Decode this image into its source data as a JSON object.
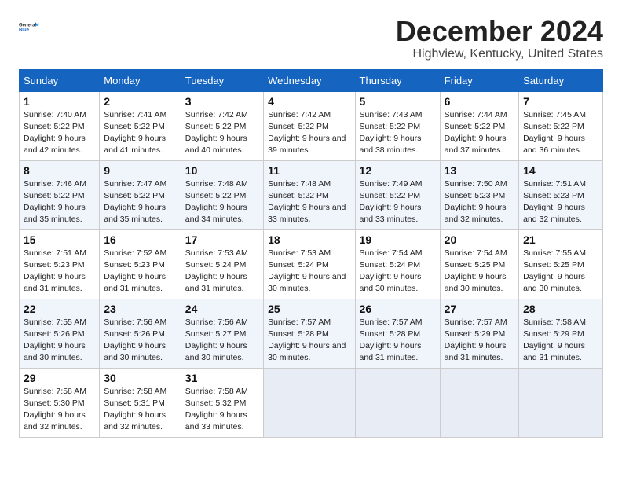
{
  "logo": {
    "line1": "General",
    "line2": "Blue"
  },
  "title": "December 2024",
  "location": "Highview, Kentucky, United States",
  "headers": [
    "Sunday",
    "Monday",
    "Tuesday",
    "Wednesday",
    "Thursday",
    "Friday",
    "Saturday"
  ],
  "weeks": [
    [
      {
        "day": "1",
        "sunrise": "7:40 AM",
        "sunset": "5:22 PM",
        "daylight": "9 hours and 42 minutes."
      },
      {
        "day": "2",
        "sunrise": "7:41 AM",
        "sunset": "5:22 PM",
        "daylight": "9 hours and 41 minutes."
      },
      {
        "day": "3",
        "sunrise": "7:42 AM",
        "sunset": "5:22 PM",
        "daylight": "9 hours and 40 minutes."
      },
      {
        "day": "4",
        "sunrise": "7:42 AM",
        "sunset": "5:22 PM",
        "daylight": "9 hours and 39 minutes."
      },
      {
        "day": "5",
        "sunrise": "7:43 AM",
        "sunset": "5:22 PM",
        "daylight": "9 hours and 38 minutes."
      },
      {
        "day": "6",
        "sunrise": "7:44 AM",
        "sunset": "5:22 PM",
        "daylight": "9 hours and 37 minutes."
      },
      {
        "day": "7",
        "sunrise": "7:45 AM",
        "sunset": "5:22 PM",
        "daylight": "9 hours and 36 minutes."
      }
    ],
    [
      {
        "day": "8",
        "sunrise": "7:46 AM",
        "sunset": "5:22 PM",
        "daylight": "9 hours and 35 minutes."
      },
      {
        "day": "9",
        "sunrise": "7:47 AM",
        "sunset": "5:22 PM",
        "daylight": "9 hours and 35 minutes."
      },
      {
        "day": "10",
        "sunrise": "7:48 AM",
        "sunset": "5:22 PM",
        "daylight": "9 hours and 34 minutes."
      },
      {
        "day": "11",
        "sunrise": "7:48 AM",
        "sunset": "5:22 PM",
        "daylight": "9 hours and 33 minutes."
      },
      {
        "day": "12",
        "sunrise": "7:49 AM",
        "sunset": "5:22 PM",
        "daylight": "9 hours and 33 minutes."
      },
      {
        "day": "13",
        "sunrise": "7:50 AM",
        "sunset": "5:23 PM",
        "daylight": "9 hours and 32 minutes."
      },
      {
        "day": "14",
        "sunrise": "7:51 AM",
        "sunset": "5:23 PM",
        "daylight": "9 hours and 32 minutes."
      }
    ],
    [
      {
        "day": "15",
        "sunrise": "7:51 AM",
        "sunset": "5:23 PM",
        "daylight": "9 hours and 31 minutes."
      },
      {
        "day": "16",
        "sunrise": "7:52 AM",
        "sunset": "5:23 PM",
        "daylight": "9 hours and 31 minutes."
      },
      {
        "day": "17",
        "sunrise": "7:53 AM",
        "sunset": "5:24 PM",
        "daylight": "9 hours and 31 minutes."
      },
      {
        "day": "18",
        "sunrise": "7:53 AM",
        "sunset": "5:24 PM",
        "daylight": "9 hours and 30 minutes."
      },
      {
        "day": "19",
        "sunrise": "7:54 AM",
        "sunset": "5:24 PM",
        "daylight": "9 hours and 30 minutes."
      },
      {
        "day": "20",
        "sunrise": "7:54 AM",
        "sunset": "5:25 PM",
        "daylight": "9 hours and 30 minutes."
      },
      {
        "day": "21",
        "sunrise": "7:55 AM",
        "sunset": "5:25 PM",
        "daylight": "9 hours and 30 minutes."
      }
    ],
    [
      {
        "day": "22",
        "sunrise": "7:55 AM",
        "sunset": "5:26 PM",
        "daylight": "9 hours and 30 minutes."
      },
      {
        "day": "23",
        "sunrise": "7:56 AM",
        "sunset": "5:26 PM",
        "daylight": "9 hours and 30 minutes."
      },
      {
        "day": "24",
        "sunrise": "7:56 AM",
        "sunset": "5:27 PM",
        "daylight": "9 hours and 30 minutes."
      },
      {
        "day": "25",
        "sunrise": "7:57 AM",
        "sunset": "5:28 PM",
        "daylight": "9 hours and 30 minutes."
      },
      {
        "day": "26",
        "sunrise": "7:57 AM",
        "sunset": "5:28 PM",
        "daylight": "9 hours and 31 minutes."
      },
      {
        "day": "27",
        "sunrise": "7:57 AM",
        "sunset": "5:29 PM",
        "daylight": "9 hours and 31 minutes."
      },
      {
        "day": "28",
        "sunrise": "7:58 AM",
        "sunset": "5:29 PM",
        "daylight": "9 hours and 31 minutes."
      }
    ],
    [
      {
        "day": "29",
        "sunrise": "7:58 AM",
        "sunset": "5:30 PM",
        "daylight": "9 hours and 32 minutes."
      },
      {
        "day": "30",
        "sunrise": "7:58 AM",
        "sunset": "5:31 PM",
        "daylight": "9 hours and 32 minutes."
      },
      {
        "day": "31",
        "sunrise": "7:58 AM",
        "sunset": "5:32 PM",
        "daylight": "9 hours and 33 minutes."
      },
      null,
      null,
      null,
      null
    ]
  ],
  "labels": {
    "sunrise": "Sunrise:",
    "sunset": "Sunset:",
    "daylight": "Daylight:"
  }
}
